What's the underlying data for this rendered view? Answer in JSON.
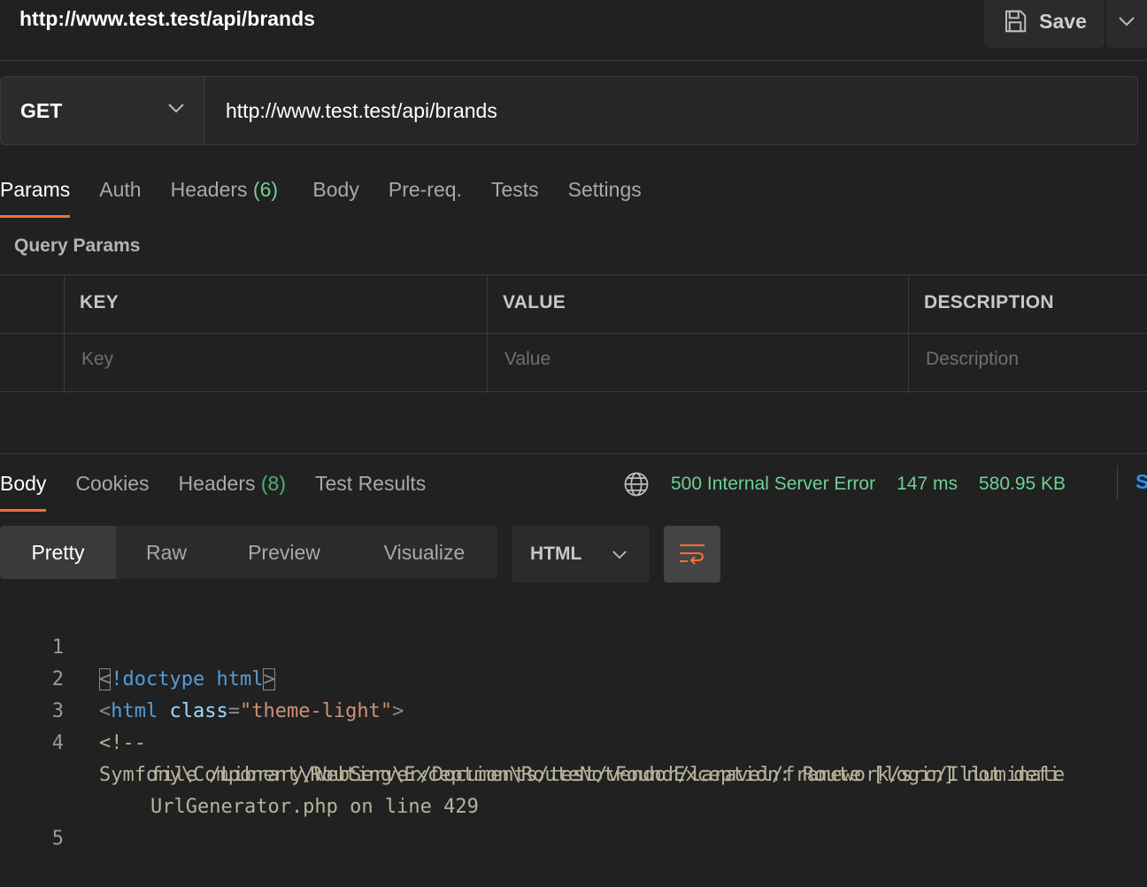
{
  "header": {
    "title": "http://www.test.test/api/brands",
    "save_label": "Save"
  },
  "request": {
    "method": "GET",
    "url": "http://www.test.test/api/brands"
  },
  "request_tabs": [
    {
      "label": "Params",
      "count": ""
    },
    {
      "label": "Auth",
      "count": ""
    },
    {
      "label": "Headers",
      "count": "(6)"
    },
    {
      "label": "Body",
      "count": ""
    },
    {
      "label": "Pre-req.",
      "count": ""
    },
    {
      "label": "Tests",
      "count": ""
    },
    {
      "label": "Settings",
      "count": ""
    }
  ],
  "query_params": {
    "label": "Query Params",
    "columns": [
      "KEY",
      "VALUE",
      "DESCRIPTION"
    ],
    "placeholders": [
      "Key",
      "Value",
      "Description"
    ]
  },
  "response_tabs": [
    {
      "label": "Body",
      "count": ""
    },
    {
      "label": "Cookies",
      "count": ""
    },
    {
      "label": "Headers",
      "count": "(8)"
    },
    {
      "label": "Test Results",
      "count": ""
    }
  ],
  "status": {
    "code_text": "500 Internal Server Error",
    "time": "147 ms",
    "size": "580.95 KB",
    "save_response_label": "S"
  },
  "format_tabs": [
    "Pretty",
    "Raw",
    "Preview",
    "Visualize"
  ],
  "language": "HTML",
  "code": {
    "line_numbers": [
      "1",
      "2",
      "3",
      "4",
      "5"
    ],
    "l1_lt": "<",
    "l1_doctype": "!doctype html",
    "l1_gt": ">",
    "l2_open": "<",
    "l2_tag": "html",
    "l2_attr": " class",
    "l2_eq": "=",
    "l2_val": "\"theme-light\"",
    "l2_close": ">",
    "l3": "<!--",
    "l4a": "Symfony\\Component\\Routing\\Exception\\RouteNotFoundException: Route [login] not defi",
    "l4b": "file /Library/WebServer/Documents/test/vendor/laravel/framework/src/Illuminate",
    "l4c": "UrlGenerator.php on line 429"
  },
  "colors": {
    "accent": "#ff6c37",
    "success": "#6fcf97",
    "link": "#2f8ff5"
  },
  "icons": [
    "save-icon",
    "chevron-down-icon",
    "globe-icon",
    "wrap-lines-icon"
  ]
}
